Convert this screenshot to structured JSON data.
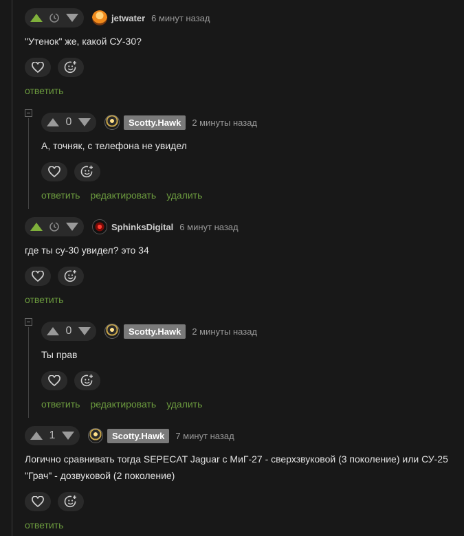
{
  "comments": [
    {
      "score": "",
      "user": "jetwater",
      "time": "6 минут назад",
      "text": "\"Утенок\" же, какой СУ-30?",
      "links": {
        "reply": "ответить"
      }
    },
    {
      "score": "0",
      "user": "Scotty.Hawk",
      "time": "2 минуты назад",
      "text": "А, точняк, с телефона не увидел",
      "links": {
        "reply": "ответить",
        "edit": "редактировать",
        "delete": "удалить"
      }
    },
    {
      "score": "",
      "user": "SphinksDigital",
      "time": "6 минут назад",
      "text": "где ты су-30 увидел? это 34",
      "links": {
        "reply": "ответить"
      }
    },
    {
      "score": "0",
      "user": "Scotty.Hawk",
      "time": "2 минуты назад",
      "text": "Ты прав",
      "links": {
        "reply": "ответить",
        "edit": "редактировать",
        "delete": "удалить"
      }
    },
    {
      "score": "1",
      "user": "Scotty.Hawk",
      "time": "7 минут назад",
      "text": "Логично сравнивать тогда SEPECAT Jaguar с МиГ-27 - сверхзвуковой (3 поколение) или СУ-25 \"Грач\" - дозвуковой (2 поколение)",
      "links": {
        "reply": "ответить"
      }
    }
  ],
  "colors": {
    "upvote_active": "#7fb03b",
    "link": "#6b9a3e",
    "background": "#181818"
  },
  "icons": [
    "upvote-icon",
    "clock-icon",
    "downvote-icon",
    "heart-icon",
    "emoji-add-icon",
    "collapse-icon"
  ]
}
